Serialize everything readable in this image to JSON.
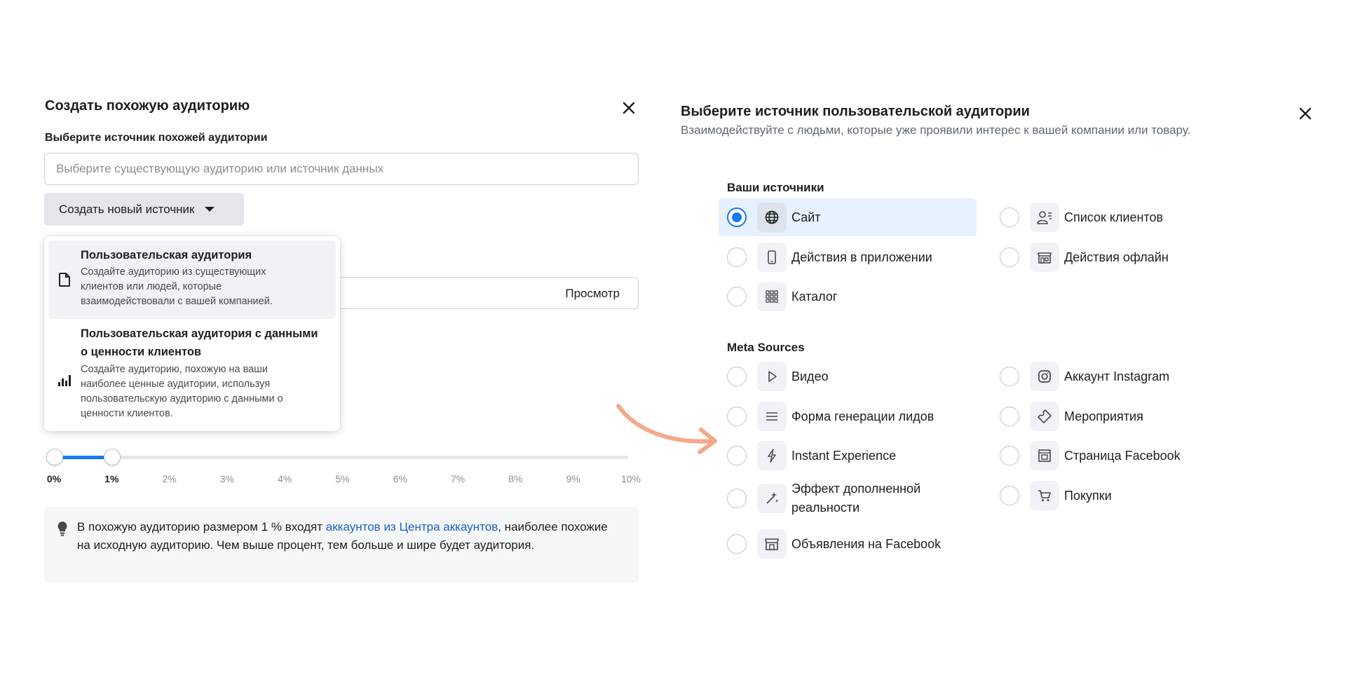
{
  "left_panel": {
    "title": "Создать похожую аудиторию",
    "source_label": "Выберите источник похожей аудитории",
    "source_placeholder": "Выберите существующую аудиторию или источник данных",
    "create_button": "Создать новый источник",
    "preview": "Просмотр",
    "dropdown": [
      {
        "title": "Пользовательская аудитория",
        "desc": [
          "Создайте аудиторию из существующих",
          "клиентов или людей, которые",
          "взаимодействовали с вашей компанией."
        ],
        "icon": "document-icon",
        "selected": true
      },
      {
        "title": [
          "Пользовательская аудитория с данными",
          "о ценности клиентов"
        ],
        "desc": [
          "Создайте аудиторию, похожую на ваши",
          "наиболее ценные аудитории, используя",
          "пользовательскую аудиторию с данными о",
          "ценности клиентов."
        ],
        "icon": "bar-chart-icon",
        "selected": false
      }
    ],
    "slider": {
      "ticks": [
        "0%",
        "1%",
        "2%",
        "3%",
        "4%",
        "5%",
        "6%",
        "7%",
        "8%",
        "9%",
        "10%"
      ],
      "range_start": 0,
      "range_end": 1
    },
    "info": {
      "before_link": "В похожую аудиторию размером 1 % входят ",
      "link": "аккаунтов из Центра аккаунтов",
      "after_link": ", наиболее похожие на исходную аудиторию. Чем выше процент, тем больше и шире будет аудитория.",
      "icon": "lightbulb-icon"
    }
  },
  "right_panel": {
    "title": "Выберите источник пользовательской аудитории",
    "subtitle": "Взаимодействуйте с людьми, которые уже проявили интерес к вашей компании или товару.",
    "your_sources": {
      "heading": "Ваши источники",
      "items": [
        {
          "label": "Сайт",
          "icon": "globe-icon",
          "selected": true
        },
        {
          "label": "Список клиентов",
          "icon": "customer-list-icon",
          "selected": false
        },
        {
          "label": "Действия в приложении",
          "icon": "mobile-app-icon",
          "selected": false
        },
        {
          "label": "Действия офлайн",
          "icon": "store-icon",
          "selected": false
        },
        {
          "label": "Каталог",
          "icon": "grid-icon",
          "selected": false
        }
      ]
    },
    "meta_sources": {
      "heading": "Meta Sources",
      "items": [
        {
          "label": "Видео",
          "icon": "play-icon"
        },
        {
          "label": "Аккаунт Instagram",
          "icon": "instagram-icon"
        },
        {
          "label": "Форма генерации лидов",
          "icon": "list-icon"
        },
        {
          "label": "Мероприятия",
          "icon": "ticket-icon"
        },
        {
          "label": "Instant Experience",
          "icon": "lightning-icon"
        },
        {
          "label": "Страница Facebook",
          "icon": "page-icon"
        },
        {
          "label": [
            "Эффект дополненной",
            "реальности"
          ],
          "icon": "sparkle-icon"
        },
        {
          "label": "Покупки",
          "icon": "cart-icon"
        },
        {
          "label": "Объявления на Facebook",
          "icon": "shop-icon"
        }
      ]
    }
  },
  "colors": {
    "accent": "#1877f2",
    "link": "#1a62c8",
    "selected_bg": "#e7f0fd",
    "arrow": "#f4a98a"
  }
}
